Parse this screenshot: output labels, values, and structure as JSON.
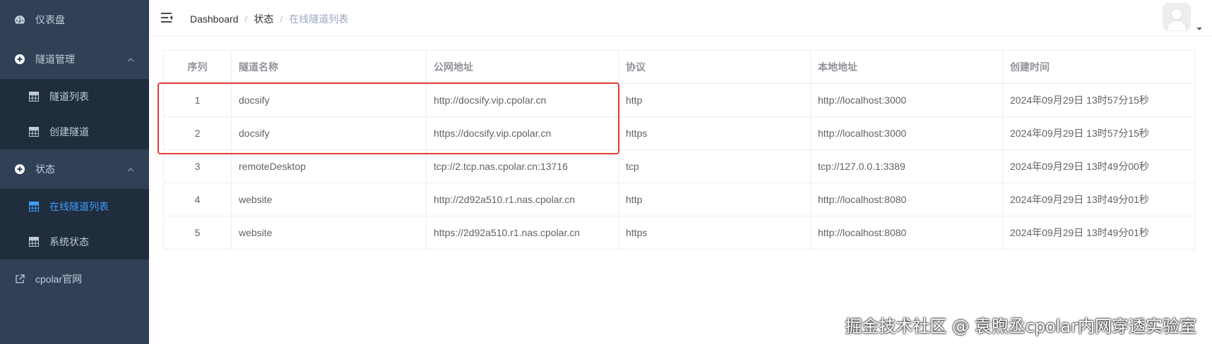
{
  "sidebar": {
    "dashboard": "仪表盘",
    "tunnel_management": "隧道管理",
    "tunnel_list": "隧道列表",
    "create_tunnel": "创建隧道",
    "status": "状态",
    "online_tunnel_list": "在线隧道列表",
    "system_status": "系统状态",
    "cpolar_site": "cpolar官网"
  },
  "breadcrumb": {
    "dashboard": "Dashboard",
    "sep1": "/",
    "status": "状态",
    "sep2": "/",
    "current": "在线隧道列表"
  },
  "table": {
    "headers": [
      "序列",
      "隧道名称",
      "公网地址",
      "协议",
      "本地地址",
      "创建时间"
    ],
    "rows": [
      [
        "1",
        "docsify",
        "http://docsify.vip.cpolar.cn",
        "http",
        "http://localhost:3000",
        "2024年09月29日 13时57分15秒"
      ],
      [
        "2",
        "docsify",
        "https://docsify.vip.cpolar.cn",
        "https",
        "http://localhost:3000",
        "2024年09月29日 13时57分15秒"
      ],
      [
        "3",
        "remoteDesktop",
        "tcp://2.tcp.nas.cpolar.cn:13716",
        "tcp",
        "tcp://127.0.0.1:3389",
        "2024年09月29日 13时49分00秒"
      ],
      [
        "4",
        "website",
        "http://2d92a510.r1.nas.cpolar.cn",
        "http",
        "http://localhost:8080",
        "2024年09月29日 13时49分01秒"
      ],
      [
        "5",
        "website",
        "https://2d92a510.r1.nas.cpolar.cn",
        "https",
        "http://localhost:8080",
        "2024年09月29日 13时49分01秒"
      ]
    ]
  },
  "watermark": "掘金技术社区 @ 袁煦丞cpolar内网穿透实验室",
  "colors": {
    "sidebar_bg": "#304156",
    "submenu_bg": "#1f2d3d",
    "active": "#409eff",
    "highlight": "#e53935"
  }
}
